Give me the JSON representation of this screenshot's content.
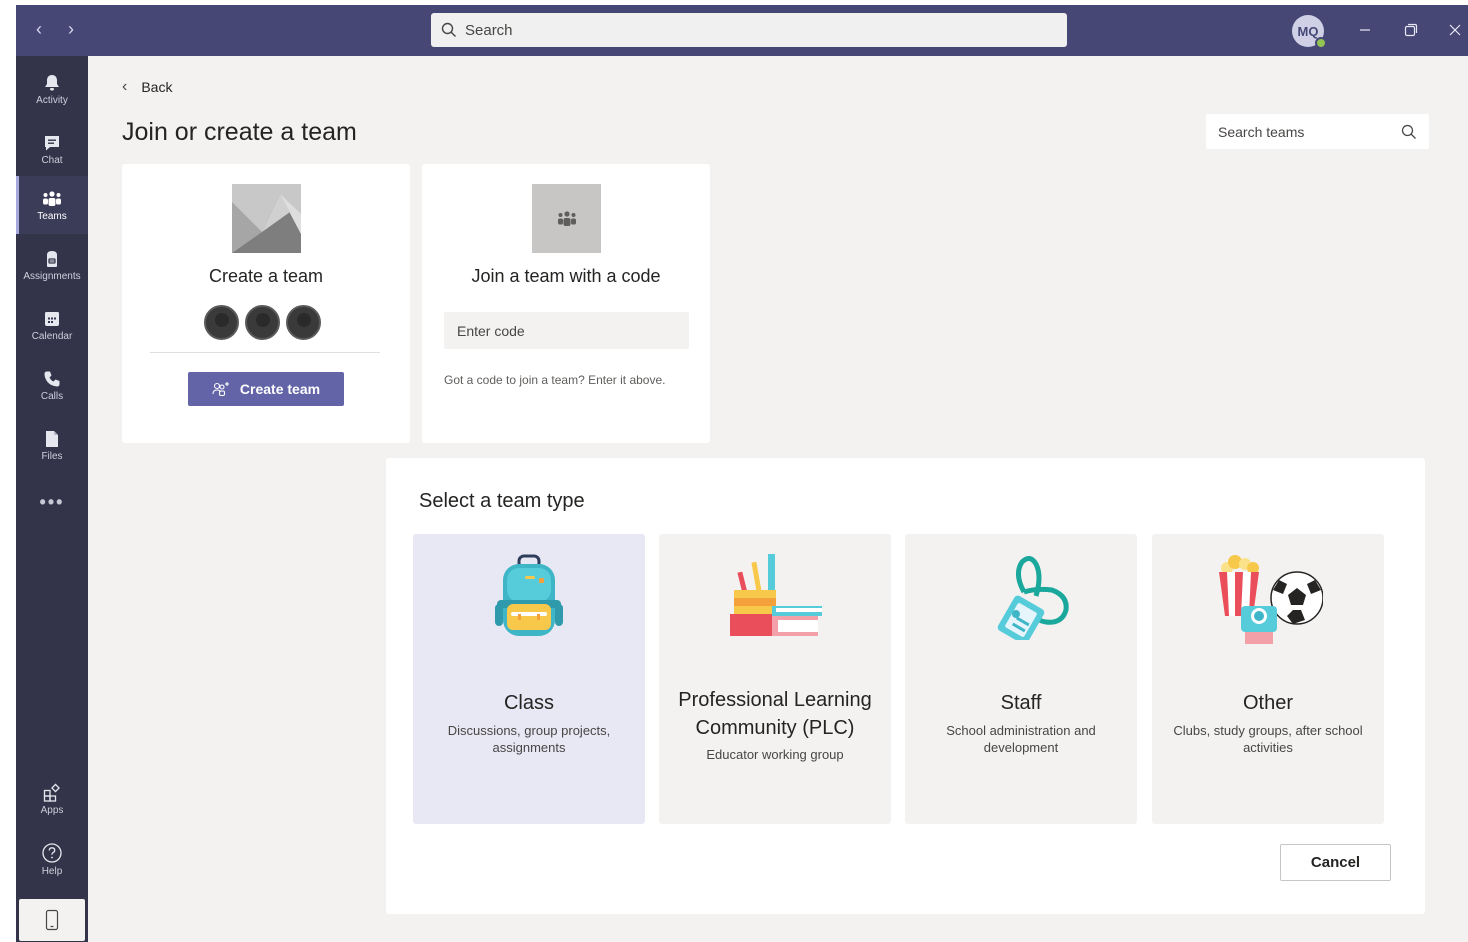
{
  "titlebar": {
    "search_placeholder": "Search",
    "avatar_initials": "MQ"
  },
  "rail": {
    "items": [
      {
        "label": "Activity",
        "icon": "bell-icon"
      },
      {
        "label": "Chat",
        "icon": "chat-icon"
      },
      {
        "label": "Teams",
        "icon": "teams-icon",
        "active": true
      },
      {
        "label": "Assignments",
        "icon": "assignments-icon"
      },
      {
        "label": "Calendar",
        "icon": "calendar-icon"
      },
      {
        "label": "Calls",
        "icon": "phone-icon"
      },
      {
        "label": "Files",
        "icon": "file-icon"
      }
    ],
    "more": "•••",
    "bottom": [
      {
        "label": "Apps",
        "icon": "apps-icon"
      },
      {
        "label": "Help",
        "icon": "help-icon"
      }
    ]
  },
  "main": {
    "back_label": "Back",
    "title": "Join or create a team",
    "search_teams_placeholder": "Search teams",
    "create_card": {
      "title": "Create a team",
      "button_label": "Create team"
    },
    "join_card": {
      "title": "Join a team with a code",
      "input_placeholder": "Enter code",
      "hint": "Got a code to join a team? Enter it above."
    }
  },
  "team_type": {
    "title": "Select a team type",
    "options": [
      {
        "name": "Class",
        "desc": "Discussions, group projects, assignments",
        "icon": "backpack-icon",
        "selected": true
      },
      {
        "name": "Professional Learning Community (PLC)",
        "desc": "Educator working group",
        "icon": "books-pencils-icon"
      },
      {
        "name": "Staff",
        "desc": "School administration and development",
        "icon": "lanyard-badge-icon"
      },
      {
        "name": "Other",
        "desc": "Clubs, study groups, after school activities",
        "icon": "popcorn-camera-ball-icon"
      }
    ],
    "cancel_label": "Cancel"
  },
  "colors": {
    "titlebar": "#464775",
    "rail": "#33344a",
    "accent": "#6264a7",
    "main_bg": "#f3f2f1"
  }
}
